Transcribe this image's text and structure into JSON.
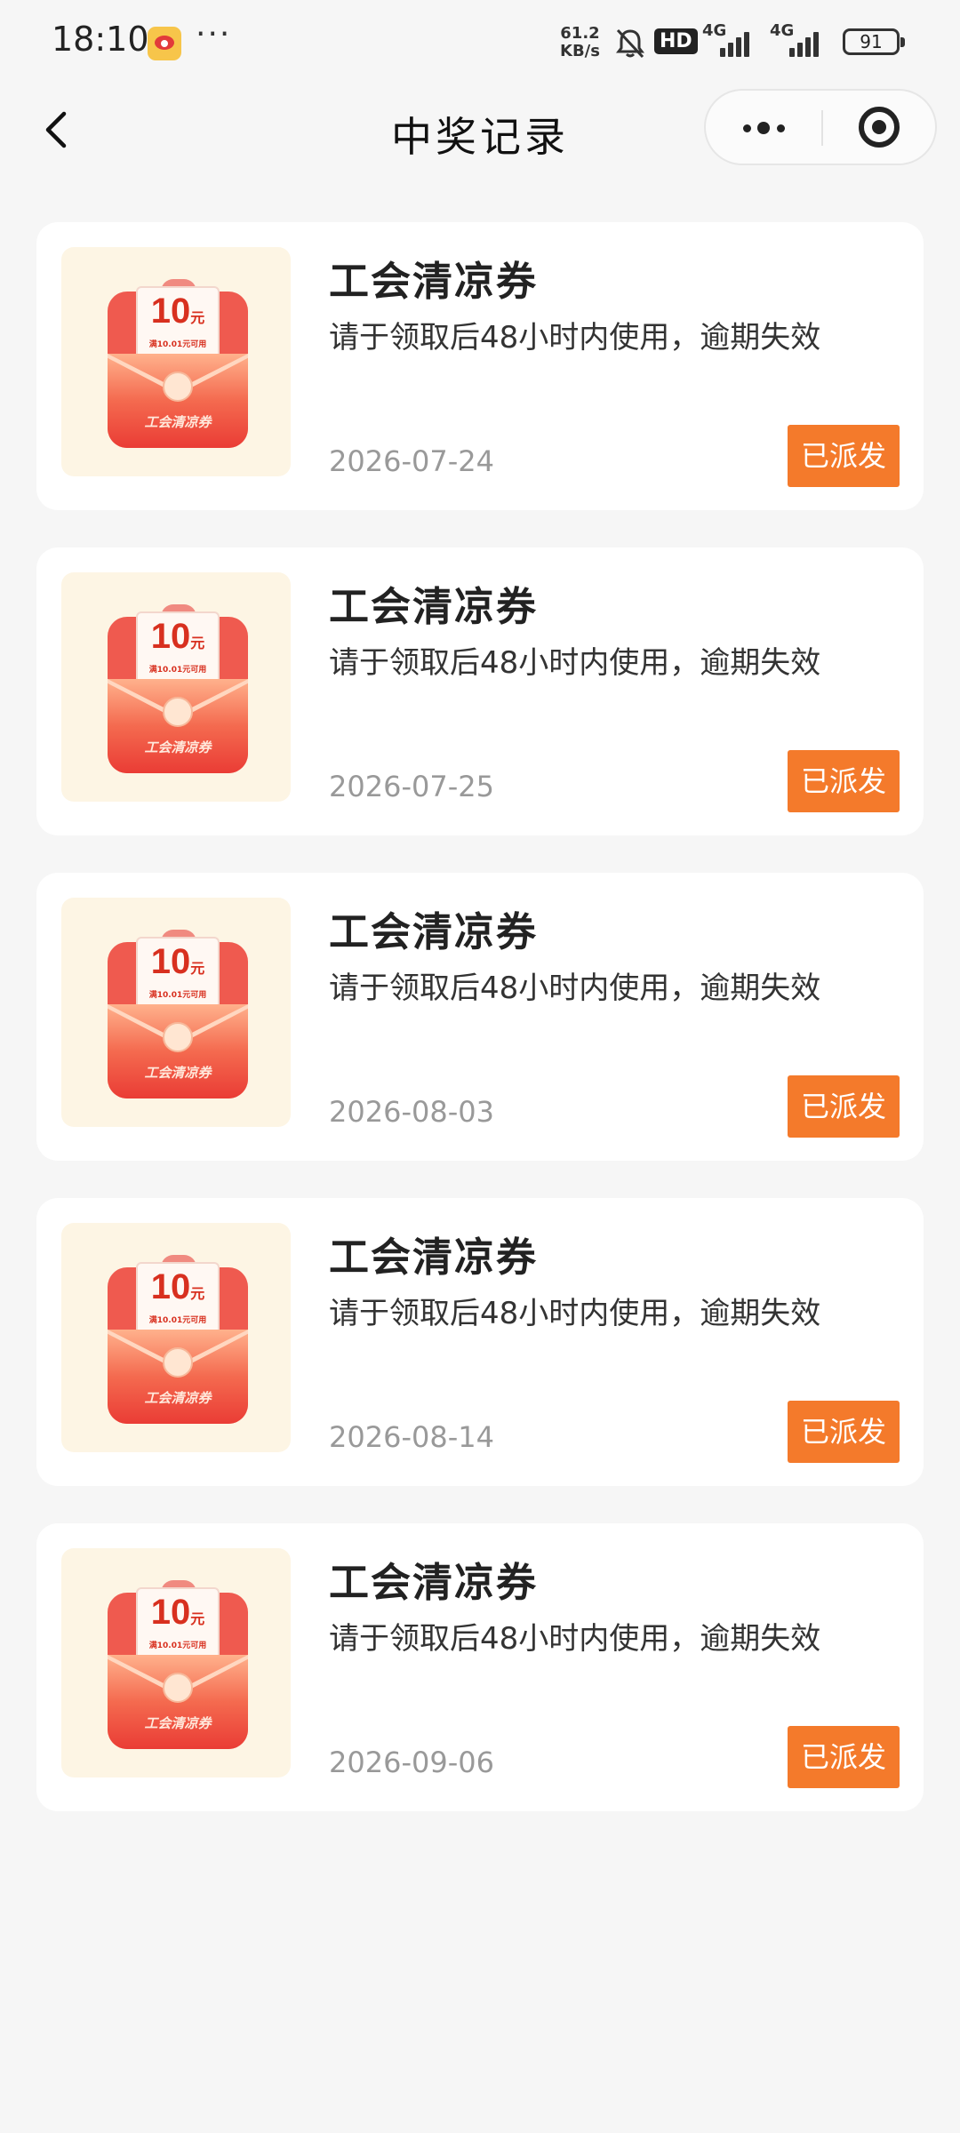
{
  "status_bar": {
    "time": "18:10",
    "more": "···",
    "speed_value": "61.2",
    "speed_unit": "KB/s",
    "hd": "HD",
    "net1": "4G",
    "net2": "4G",
    "battery": "91"
  },
  "nav": {
    "title": "中奖记录"
  },
  "records": [
    {
      "title": "工会清凉券",
      "desc": "请于领取后48小时内使用，逾期失效",
      "date": "2026-07-24",
      "status": "已派发",
      "coupon_amount": "10",
      "coupon_unit": "元",
      "coupon_cond": "满10.01元可用",
      "coupon_brand": "工会清凉券"
    },
    {
      "title": "工会清凉券",
      "desc": "请于领取后48小时内使用，逾期失效",
      "date": "2026-07-25",
      "status": "已派发",
      "coupon_amount": "10",
      "coupon_unit": "元",
      "coupon_cond": "满10.01元可用",
      "coupon_brand": "工会清凉券"
    },
    {
      "title": "工会清凉券",
      "desc": "请于领取后48小时内使用，逾期失效",
      "date": "2026-08-03",
      "status": "已派发",
      "coupon_amount": "10",
      "coupon_unit": "元",
      "coupon_cond": "满10.01元可用",
      "coupon_brand": "工会清凉券"
    },
    {
      "title": "工会清凉券",
      "desc": "请于领取后48小时内使用，逾期失效",
      "date": "2026-08-14",
      "status": "已派发",
      "coupon_amount": "10",
      "coupon_unit": "元",
      "coupon_cond": "满10.01元可用",
      "coupon_brand": "工会清凉券"
    },
    {
      "title": "工会清凉券",
      "desc": "请于领取后48小时内使用，逾期失效",
      "date": "2026-09-06",
      "status": "已派发",
      "coupon_amount": "10",
      "coupon_unit": "元",
      "coupon_cond": "满10.01元可用",
      "coupon_brand": "工会清凉券"
    }
  ],
  "colors": {
    "accent": "#f47a2b",
    "background": "#f6f6f6",
    "card": "#ffffff",
    "date": "#999999"
  }
}
